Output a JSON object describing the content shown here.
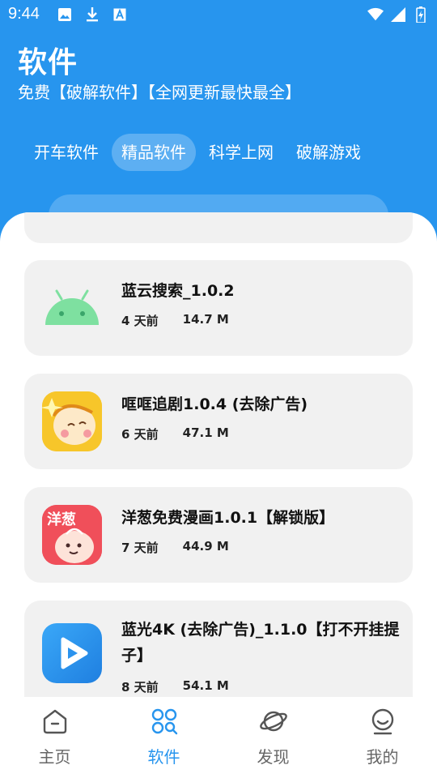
{
  "status_bar": {
    "time": "9:44",
    "left_icons": [
      "image-icon",
      "download-icon",
      "font-icon"
    ],
    "right_icons": [
      "wifi-icon",
      "signal-icon",
      "battery-icon"
    ]
  },
  "header": {
    "title": "软件",
    "subtitle": "免费【破解软件】【全网更新最快最全】"
  },
  "tabs": [
    {
      "label": "开车软件",
      "active": false
    },
    {
      "label": "精品软件",
      "active": true
    },
    {
      "label": "科学上网",
      "active": false
    },
    {
      "label": "破解游戏",
      "active": false
    }
  ],
  "apps": [
    {
      "name": "蓝云搜索_1.0.2",
      "age": "4 天前",
      "size": "14.7 M",
      "icon": "android-icon"
    },
    {
      "name": "哐哐追剧1.0.4 (去除广告)",
      "age": "6 天前",
      "size": "47.1 M",
      "icon": "kuangkuang-app-icon"
    },
    {
      "name": "洋葱免费漫画1.0.1【解锁版】",
      "age": "7 天前",
      "size": "44.9 M",
      "icon": "onion-comic-app-icon",
      "icon_text": "洋葱"
    },
    {
      "name": "蓝光4K (去除广告)_1.1.0【打不开挂提子】",
      "age": "8 天前",
      "size": "54.1 M",
      "icon": "play-app-icon"
    }
  ],
  "bottom_nav": [
    {
      "label": "主页",
      "icon": "home-icon",
      "active": false
    },
    {
      "label": "软件",
      "icon": "apps-grid-icon",
      "active": true
    },
    {
      "label": "发现",
      "icon": "planet-icon",
      "active": false
    },
    {
      "label": "我的",
      "icon": "profile-icon",
      "active": false
    }
  ],
  "colors": {
    "accent": "#2795ee",
    "card": "#f1f1f1",
    "android_green": "#7ee0a0"
  }
}
